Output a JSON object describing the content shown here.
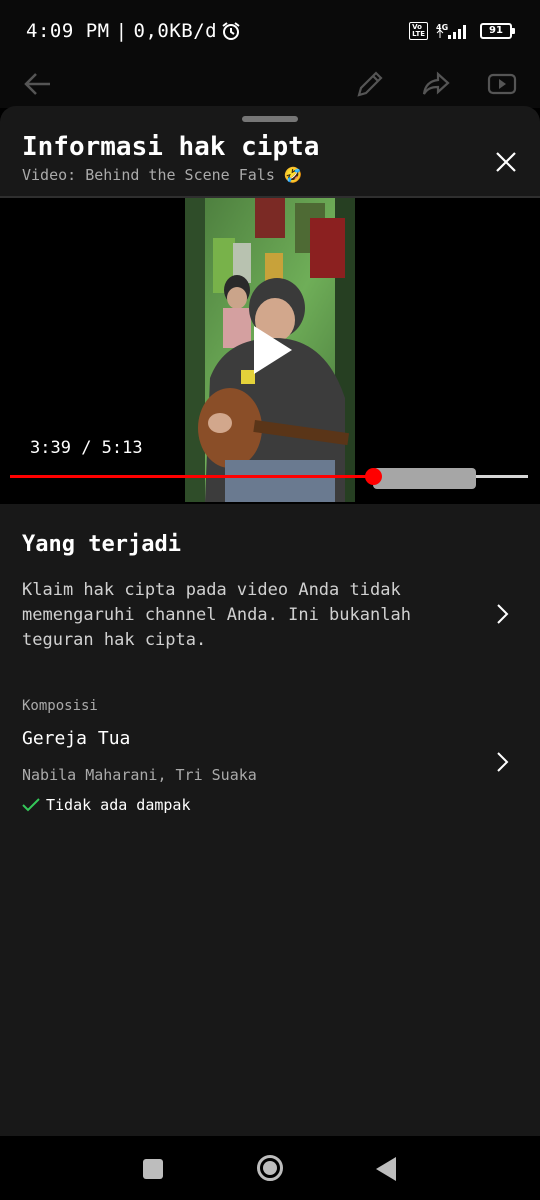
{
  "status_bar": {
    "time": "4:09 PM",
    "separator": "|",
    "network_speed": "0,0KB/d",
    "alarm_icon": "alarm-icon",
    "volte": "Vo\nLTE",
    "signal": "4G",
    "battery": "91"
  },
  "app_bar": {
    "back_icon": "arrow-left-icon",
    "edit_icon": "pencil-icon",
    "share_icon": "share-icon",
    "youtube_icon": "youtube-icon"
  },
  "sheet": {
    "title": "Informasi hak cipta",
    "subtitle": "Video: Behind the Scene Fals 🤣",
    "close_icon": "close-icon"
  },
  "video": {
    "current_time": "3:39",
    "time_separator": " / ",
    "duration": "5:13",
    "progress": 0.7,
    "buffered_to": 0.9
  },
  "what_happened": {
    "title": "Yang terjadi",
    "text": "Klaim hak cipta pada video Anda tidak memengaruhi channel Anda. Ini bukanlah teguran hak cipta."
  },
  "composition": {
    "label": "Komposisi",
    "title": "Gereja Tua",
    "artists": "Nabila Maharani, Tri Suaka",
    "impact": "Tidak ada dampak"
  },
  "colors": {
    "accent": "#ff0000",
    "check": "#34c759",
    "sheet_bg": "#181818"
  }
}
